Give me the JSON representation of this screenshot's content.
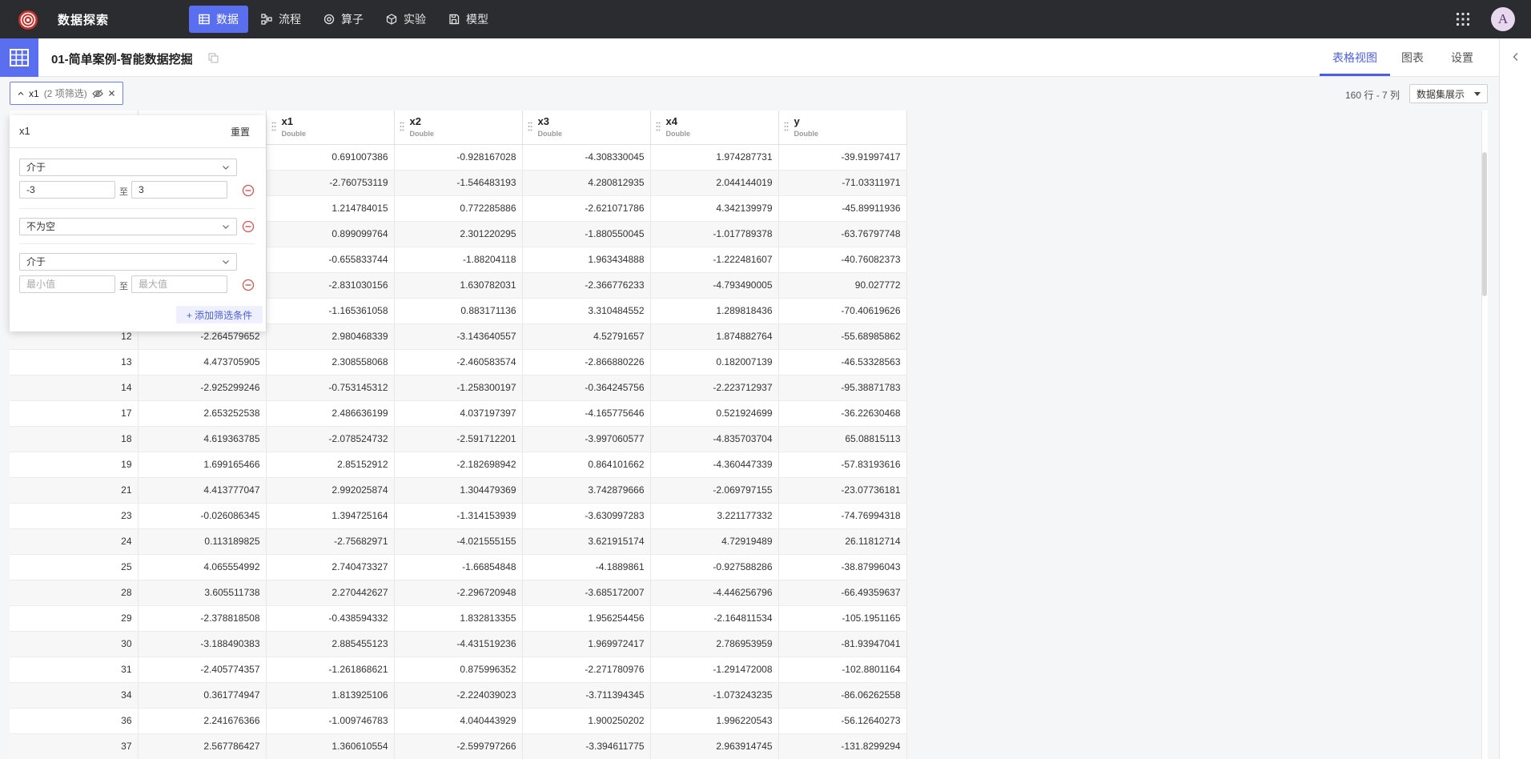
{
  "app": {
    "title": "数据探索"
  },
  "topnav": [
    {
      "label": "数据",
      "icon": "table-icon",
      "active": true
    },
    {
      "label": "流程",
      "icon": "flow-icon",
      "active": false
    },
    {
      "label": "算子",
      "icon": "operator-icon",
      "active": false
    },
    {
      "label": "实验",
      "icon": "experiment-icon",
      "active": false
    },
    {
      "label": "模型",
      "icon": "model-icon",
      "active": false
    }
  ],
  "user": {
    "avatar_letter": "A"
  },
  "header": {
    "title": "01-简单案例-智能数据挖掘",
    "tabs": [
      {
        "label": "表格视图",
        "active": true
      },
      {
        "label": "图表",
        "active": false
      },
      {
        "label": "设置",
        "active": false
      }
    ]
  },
  "filter_chip": {
    "label": "x1",
    "count": "(2 项筛选)"
  },
  "toolbar": {
    "row_col_count": "160 行 - 7 列",
    "dataset_select": "数据集展示"
  },
  "popover": {
    "title": "x1",
    "reset": "重置",
    "condition1": {
      "operator": "介于",
      "min": "-3",
      "sep": "至",
      "max": "3"
    },
    "condition2": {
      "operator": "不为空"
    },
    "condition3": {
      "operator": "介于",
      "min_placeholder": "最小值",
      "sep": "至",
      "max_placeholder": "最大值"
    },
    "add_condition": "+ 添加筛选条件"
  },
  "table": {
    "columns": [
      {
        "name": "",
        "type": ""
      },
      {
        "name": "",
        "type": ""
      },
      {
        "name": "x1",
        "type": "Double"
      },
      {
        "name": "x2",
        "type": "Double"
      },
      {
        "name": "x3",
        "type": "Double"
      },
      {
        "name": "x4",
        "type": "Double"
      },
      {
        "name": "y",
        "type": "Double"
      }
    ],
    "rows": [
      [
        "",
        "",
        "0.691007386",
        "-0.928167028",
        "-4.308330045",
        "1.974287731",
        "-39.91997417"
      ],
      [
        "",
        "",
        "-2.760753119",
        "-1.546483193",
        "4.280812935",
        "2.044144019",
        "-71.03311971"
      ],
      [
        "",
        "",
        "1.214784015",
        "0.772285886",
        "-2.621071786",
        "4.342139979",
        "-45.89911936"
      ],
      [
        "",
        "",
        "0.899099764",
        "2.301220295",
        "-1.880550045",
        "-1.017789378",
        "-63.76797748"
      ],
      [
        "",
        "",
        "-0.655833744",
        "-1.88204118",
        "1.963434888",
        "-1.222481607",
        "-40.76082373"
      ],
      [
        "",
        "",
        "-2.831030156",
        "1.630782031",
        "-2.366776233",
        "-4.793490005",
        "90.027772"
      ],
      [
        "",
        "",
        "-1.165361058",
        "0.883171136",
        "3.310484552",
        "1.289818436",
        "-70.40619626"
      ],
      [
        "12",
        "-2.264579652",
        "2.980468339",
        "-3.143640557",
        "4.52791657",
        "1.874882764",
        "-55.68985862"
      ],
      [
        "13",
        "4.473705905",
        "2.308558068",
        "-2.460583574",
        "-2.866880226",
        "0.182007139",
        "-46.53328563"
      ],
      [
        "14",
        "-2.925299246",
        "-0.753145312",
        "-1.258300197",
        "-0.364245756",
        "-2.223712937",
        "-95.38871783"
      ],
      [
        "17",
        "2.653252538",
        "2.486636199",
        "4.037197397",
        "-4.165775646",
        "0.521924699",
        "-36.22630468"
      ],
      [
        "18",
        "4.619363785",
        "-2.078524732",
        "-2.591712201",
        "-3.997060577",
        "-4.835703704",
        "65.08815113"
      ],
      [
        "19",
        "1.699165466",
        "2.85152912",
        "-2.182698942",
        "0.864101662",
        "-4.360447339",
        "-57.83193616"
      ],
      [
        "21",
        "4.413777047",
        "2.992025874",
        "1.304479369",
        "3.742879666",
        "-2.069797155",
        "-23.07736181"
      ],
      [
        "23",
        "-0.026086345",
        "1.394725164",
        "-1.314153939",
        "-3.630997283",
        "3.221177332",
        "-74.76994318"
      ],
      [
        "24",
        "0.113189825",
        "-2.75682971",
        "-4.021555155",
        "3.621915174",
        "4.72919489",
        "26.11812714"
      ],
      [
        "25",
        "4.065554992",
        "2.740473327",
        "-1.66854848",
        "-4.1889861",
        "-0.927588286",
        "-38.87996043"
      ],
      [
        "28",
        "3.605511738",
        "2.270442627",
        "-2.296720948",
        "-3.685172007",
        "-4.446256796",
        "-66.49359637"
      ],
      [
        "29",
        "-2.378818508",
        "-0.438594332",
        "1.832813355",
        "1.956254456",
        "-2.164811534",
        "-105.1951165"
      ],
      [
        "30",
        "-3.188490383",
        "2.885455123",
        "-4.431519236",
        "1.969972417",
        "2.786953959",
        "-81.93947041"
      ],
      [
        "31",
        "-2.405774357",
        "-1.261868621",
        "0.875996352",
        "-2.271780976",
        "-1.291472008",
        "-102.8801164"
      ],
      [
        "34",
        "0.361774947",
        "1.813925106",
        "-2.224039023",
        "-3.711394345",
        "-1.073243235",
        "-86.06262558"
      ],
      [
        "36",
        "2.241676366",
        "-1.009746783",
        "4.040443929",
        "1.900250202",
        "1.996220543",
        "-56.12640273"
      ],
      [
        "37",
        "2.567786427",
        "1.360610554",
        "-2.599797266",
        "-3.394611775",
        "2.963914745",
        "-131.8299294"
      ]
    ]
  }
}
